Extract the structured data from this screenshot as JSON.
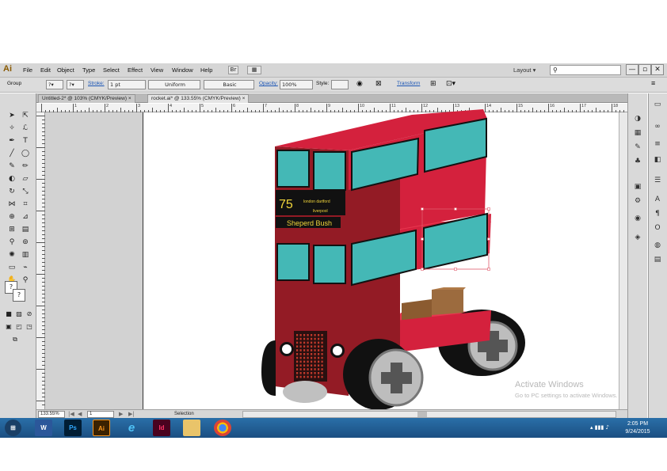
{
  "app": {
    "logo": "Ai"
  },
  "menu": [
    "File",
    "Edit",
    "Object",
    "Type",
    "Select",
    "Effect",
    "View",
    "Window",
    "Help"
  ],
  "workspace": {
    "label": "Layout",
    "arrow": "▾"
  },
  "window_controls": {
    "minimize": "—",
    "restore": "▫",
    "close": "✕"
  },
  "control_bar": {
    "selection": "Group",
    "stroke_label": "Stroke:",
    "stroke_value": "1 pt",
    "profile": "Uniform",
    "brush": "Basic",
    "opacity_label": "Opacity:",
    "opacity_value": "100%",
    "style_label": "Style:",
    "transform_label": "Transform"
  },
  "tabs": [
    {
      "label": "Untitled-2* @ 103% (CMYK/Preview)",
      "close": "×"
    },
    {
      "label": "rocket.ai* @ 133.55% (CMYK/Preview)",
      "close": "×"
    }
  ],
  "ruler_numbers": [
    "1",
    "2",
    "3",
    "4",
    "5",
    "6",
    "7",
    "8",
    "9",
    "10",
    "11",
    "12",
    "13",
    "14",
    "15",
    "16",
    "17",
    "18"
  ],
  "status": {
    "zoom": "133.55%",
    "artboard": "1",
    "tool": "Selection"
  },
  "bus": {
    "route_number": "75",
    "dest_line1": "london  dartford",
    "dest_line2": "liverpool",
    "destination": "Sheperd Bush"
  },
  "watermark": {
    "title": "Activate Windows",
    "subtitle": "Go to PC settings to activate Windows."
  },
  "taskbar": {
    "apps": [
      {
        "name": "word",
        "label": "W"
      },
      {
        "name": "photoshop",
        "label": "Ps"
      },
      {
        "name": "illustrator",
        "label": "Ai"
      },
      {
        "name": "internet-explorer",
        "label": "e"
      },
      {
        "name": "indesign",
        "label": "Id"
      },
      {
        "name": "file-explorer",
        "label": ""
      },
      {
        "name": "chrome",
        "label": ""
      }
    ],
    "time": "2:05 PM",
    "date": "9/24/2015"
  },
  "colors": {
    "bus_red": "#d4213d",
    "bus_dark_red": "#931b25",
    "window_teal": "#44b8b6",
    "box_brown": "#9c6b3e",
    "ai_orange": "#f7941d"
  }
}
